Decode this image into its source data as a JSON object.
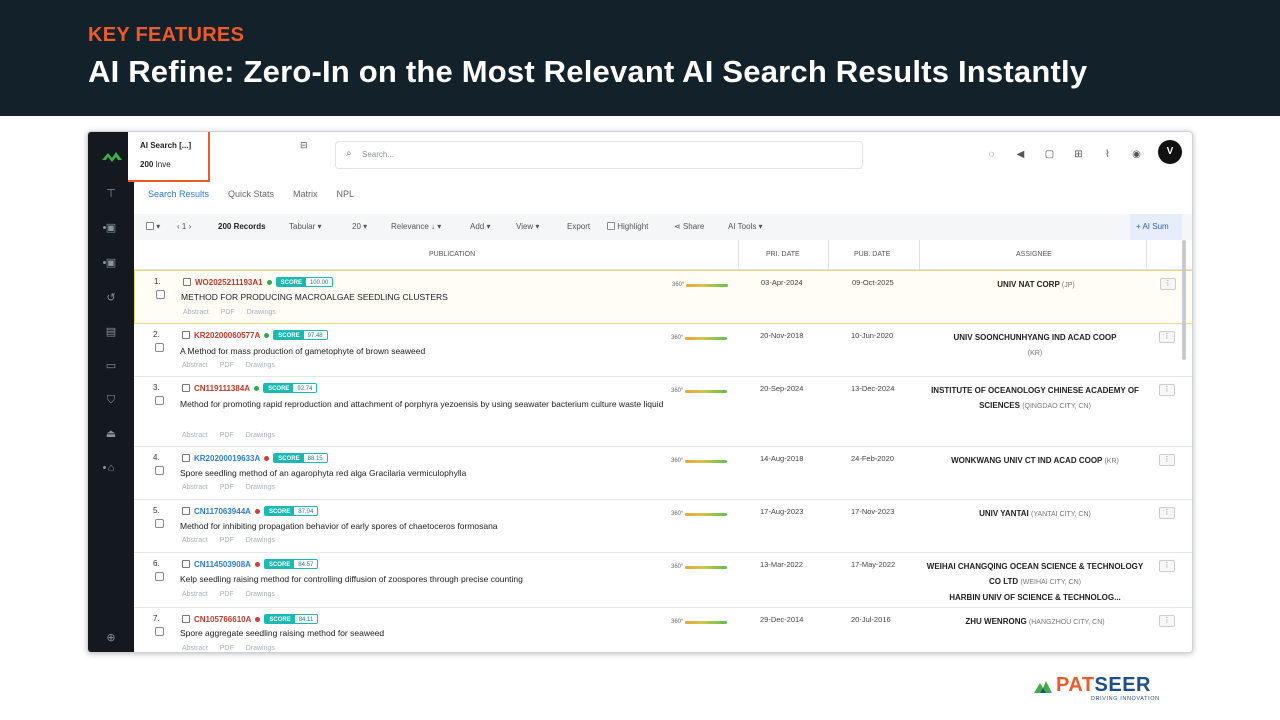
{
  "slide": {
    "kicker": "KEY FEATURES",
    "title": "AI Refine: Zero-In on the Most Relevant AI Search Results Instantly"
  },
  "app": {
    "search_tab": {
      "name": "AI Search [...]",
      "count": "200",
      "count_suffix": " Inve"
    },
    "search_placeholder": "Search...",
    "avatar_initial": "V",
    "sub_tabs": [
      "Search Results",
      "Quick Stats",
      "Matrix",
      "NPL"
    ],
    "toolbar": {
      "page": "1",
      "records": "200 Records",
      "view_mode": "Tabular",
      "per_page": "20",
      "sort": "Relevance ↓",
      "add": "Add",
      "view": "View",
      "export": "Export",
      "highlight": "Highlight",
      "share": "Share",
      "ai_tools": "AI Tools",
      "ai_summary": "+ AI Sum"
    },
    "columns": [
      "PUBLICATION",
      "PRI. DATE",
      "PUB. DATE",
      "ASSIGNEE"
    ],
    "links": [
      "Abstract",
      "PDF",
      "Drawings"
    ],
    "insight_label": "360°",
    "score_label": "SCORE",
    "rows": [
      {
        "num": "1.",
        "pn": "WO2025211193A1",
        "pn_color": "red",
        "dot": "#2fa84f",
        "score": "100.00",
        "title": "METHOD FOR PRODUCING MACROALGAE SEEDLING CLUSTERS",
        "pri": "03-Apr-2024",
        "pub": "09-Oct-2025",
        "assignee": "UNIV NAT CORP",
        "loc": "(JP)"
      },
      {
        "num": "2.",
        "pn": "KR20200060577A",
        "pn_color": "red",
        "dot": "#2fa84f",
        "score": "97.48",
        "title": "A Method for mass production of gametophyte of brown seaweed",
        "pri": "20-Nov-2018",
        "pub": "10-Jun-2020",
        "assignee": "UNIV SOONCHUNHYANG IND ACAD COOP",
        "loc": "(KR)"
      },
      {
        "num": "3.",
        "pn": "CN119111384A",
        "pn_color": "red",
        "dot": "#2fa84f",
        "score": "92.74",
        "title": "Method for promoting rapid reproduction and attachment of porphyra yezoensis by using seawater bacterium culture waste liquid",
        "pri": "20-Sep-2024",
        "pub": "13-Dec-2024",
        "assignee": "INSTITUTE OF OCEANOLOGY CHINESE ACADEMY OF SCIENCES",
        "loc": "(QINGDAO CITY, CN)"
      },
      {
        "num": "4.",
        "pn": "KR20200019633A",
        "pn_color": "blue",
        "dot": "#d23c3c",
        "score": "88.15",
        "title": "Spore seedling method of an agarophyta red alga Gracilaria vermiculophylla",
        "pri": "14-Aug-2018",
        "pub": "24-Feb-2020",
        "assignee": "WONKWANG UNIV CT IND ACAD COOP",
        "loc": "(KR)"
      },
      {
        "num": "5.",
        "pn": "CN117063944A",
        "pn_color": "blue",
        "dot": "#d23c3c",
        "score": "87.04",
        "title": "Method for inhibiting propagation behavior of early spores of chaetoceros formosana",
        "pri": "17-Aug-2023",
        "pub": "17-Nov-2023",
        "assignee": "UNIV YANTAI",
        "loc": "(YANTAI CITY, CN)"
      },
      {
        "num": "6.",
        "pn": "CN114503908A",
        "pn_color": "blue",
        "dot": "#d23c3c",
        "score": "84.57",
        "title": "Kelp seedling raising method for controlling diffusion of zoospores through precise counting",
        "pri": "13-Mar-2022",
        "pub": "17-May-2022",
        "assignee": "WEIHAI CHANGQING OCEAN SCIENCE & TECHNOLOGY CO LTD",
        "loc": "(WEIHAI CITY, CN)",
        "assignee2": "HARBIN UNIV OF SCIENCE & TECHNOLOG..."
      },
      {
        "num": "7.",
        "pn": "CN105766610A",
        "pn_color": "red",
        "dot": "#d23c3c",
        "score": "84.11",
        "title": "Spore aggregate seedling raising method for seaweed",
        "pri": "29-Dec-2014",
        "pub": "20-Jul-2016",
        "assignee": "ZHU WENRONG",
        "loc": "(HANGZHOU CITY, CN)"
      }
    ]
  },
  "brand": {
    "part1": "PAT",
    "part2": "SEER",
    "tagline": "DRIVING INNOVATION"
  }
}
